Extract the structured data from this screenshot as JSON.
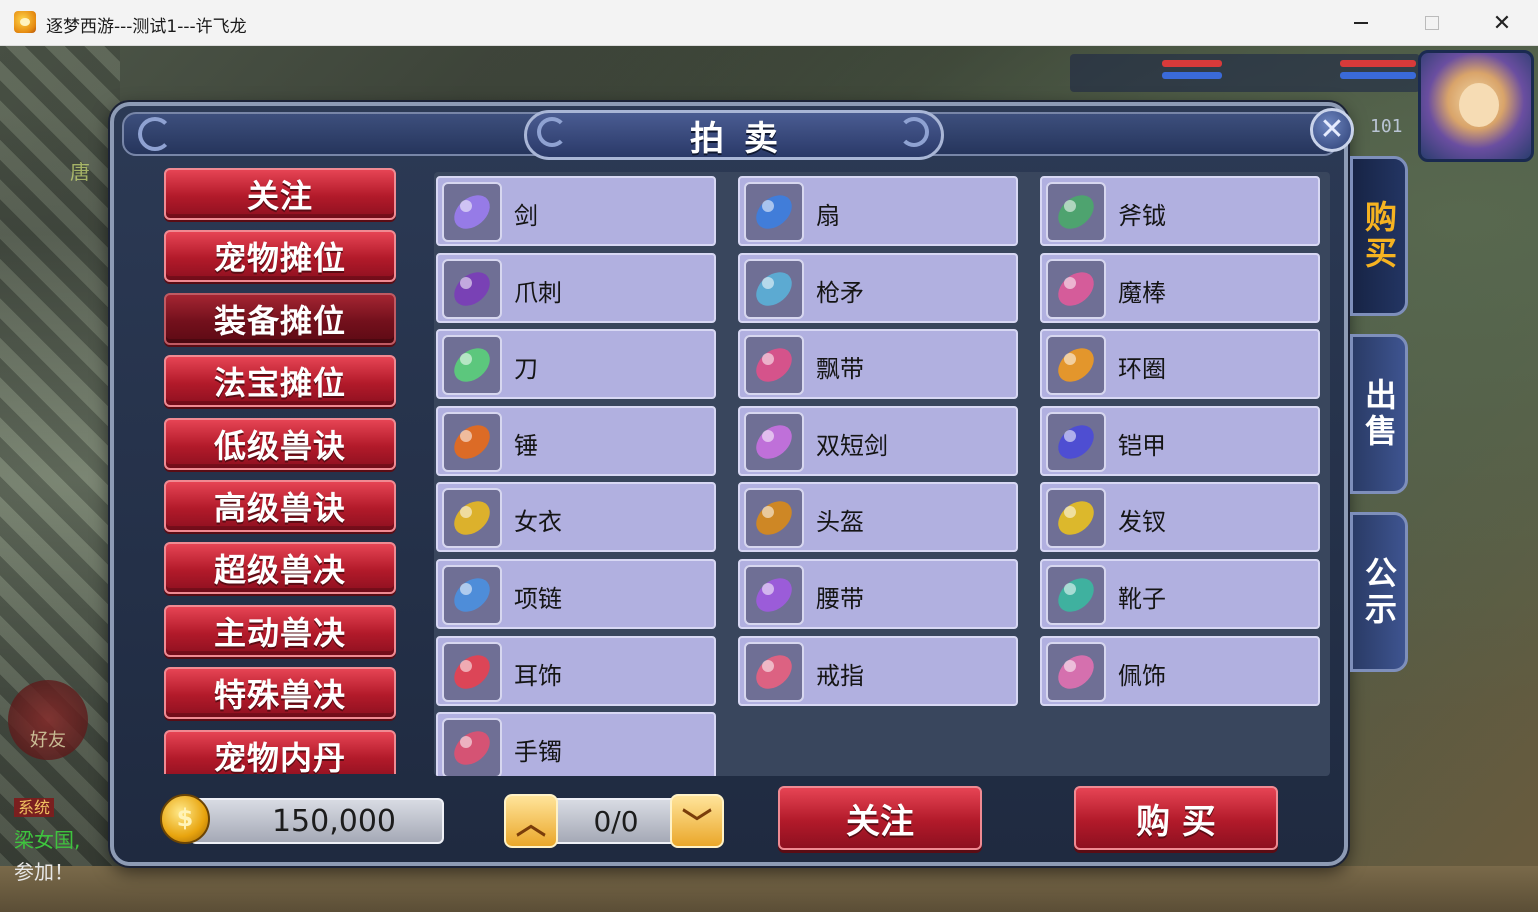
{
  "window": {
    "title": "逐梦西游---测试1---许飞龙",
    "minimize_icon": "minimize-icon",
    "maximize_icon": "maximize-icon",
    "close_icon": "close-icon",
    "close_glyph": "✕"
  },
  "hud": {
    "level": "101",
    "scene_text": "唐",
    "friend_label": "好友",
    "chat": {
      "sys_tag": "系统",
      "line2": "梁女国,",
      "line3": "参加！"
    }
  },
  "dialog": {
    "title": "拍卖",
    "close_glyph": "✕"
  },
  "categories": [
    {
      "label": "关注",
      "selected": false
    },
    {
      "label": "宠物摊位",
      "selected": false
    },
    {
      "label": "装备摊位",
      "selected": true
    },
    {
      "label": "法宝摊位",
      "selected": false
    },
    {
      "label": "低级兽诀",
      "selected": false
    },
    {
      "label": "高级兽诀",
      "selected": false
    },
    {
      "label": "超级兽决",
      "selected": false
    },
    {
      "label": "主动兽决",
      "selected": false
    },
    {
      "label": "特殊兽决",
      "selected": false
    },
    {
      "label": "宠物内丹",
      "selected": false
    }
  ],
  "items": [
    {
      "label": "剑",
      "icon": "sword-icon",
      "color": "#9a7cf0"
    },
    {
      "label": "扇",
      "icon": "fan-icon",
      "color": "#3c7ee0"
    },
    {
      "label": "斧钺",
      "icon": "axe-icon",
      "color": "#4aa86a"
    },
    {
      "label": "爪刺",
      "icon": "claw-icon",
      "color": "#7a3cb8"
    },
    {
      "label": "枪矛",
      "icon": "spear-icon",
      "color": "#5ab0d8"
    },
    {
      "label": "魔棒",
      "icon": "wand-icon",
      "color": "#e05a9a"
    },
    {
      "label": "刀",
      "icon": "blade-icon",
      "color": "#5ad07a"
    },
    {
      "label": "飘带",
      "icon": "ribbon-icon",
      "color": "#e0508a"
    },
    {
      "label": "环圈",
      "icon": "ring-weapon-icon",
      "color": "#f09a20"
    },
    {
      "label": "锤",
      "icon": "hammer-icon",
      "color": "#e86a1a"
    },
    {
      "label": "双短剑",
      "icon": "twin-daggers-icon",
      "color": "#c870e0"
    },
    {
      "label": "铠甲",
      "icon": "armor-icon",
      "color": "#4a4ad8"
    },
    {
      "label": "女衣",
      "icon": "robe-icon",
      "color": "#e8b820"
    },
    {
      "label": "头盔",
      "icon": "helmet-icon",
      "color": "#d88a18"
    },
    {
      "label": "发钗",
      "icon": "hairpin-icon",
      "color": "#e8c020"
    },
    {
      "label": "项链",
      "icon": "necklace-icon",
      "color": "#4a90e0"
    },
    {
      "label": "腰带",
      "icon": "belt-icon",
      "color": "#a05ae0"
    },
    {
      "label": "靴子",
      "icon": "boots-icon",
      "color": "#3ab8a0"
    },
    {
      "label": "耳饰",
      "icon": "earring-icon",
      "color": "#e84050"
    },
    {
      "label": "戒指",
      "icon": "finger-ring-icon",
      "color": "#e86080"
    },
    {
      "label": "佩饰",
      "icon": "pendant-icon",
      "color": "#e070b0"
    },
    {
      "label": "手镯",
      "icon": "bracelet-icon",
      "color": "#e05070"
    }
  ],
  "tabs": [
    {
      "label": "购买",
      "active": true
    },
    {
      "label": "出售",
      "active": false
    },
    {
      "label": "公示",
      "active": false
    }
  ],
  "footer": {
    "money": "150,000",
    "page": "0/0",
    "up_glyph": "︿",
    "down_glyph": "﹀",
    "follow_label": "关注",
    "buy_label": "购 买"
  },
  "colors": {
    "accent_red": "#b21a2a",
    "cell_bg": "#b1b0e0",
    "active_tab_text": "#f6b321"
  }
}
